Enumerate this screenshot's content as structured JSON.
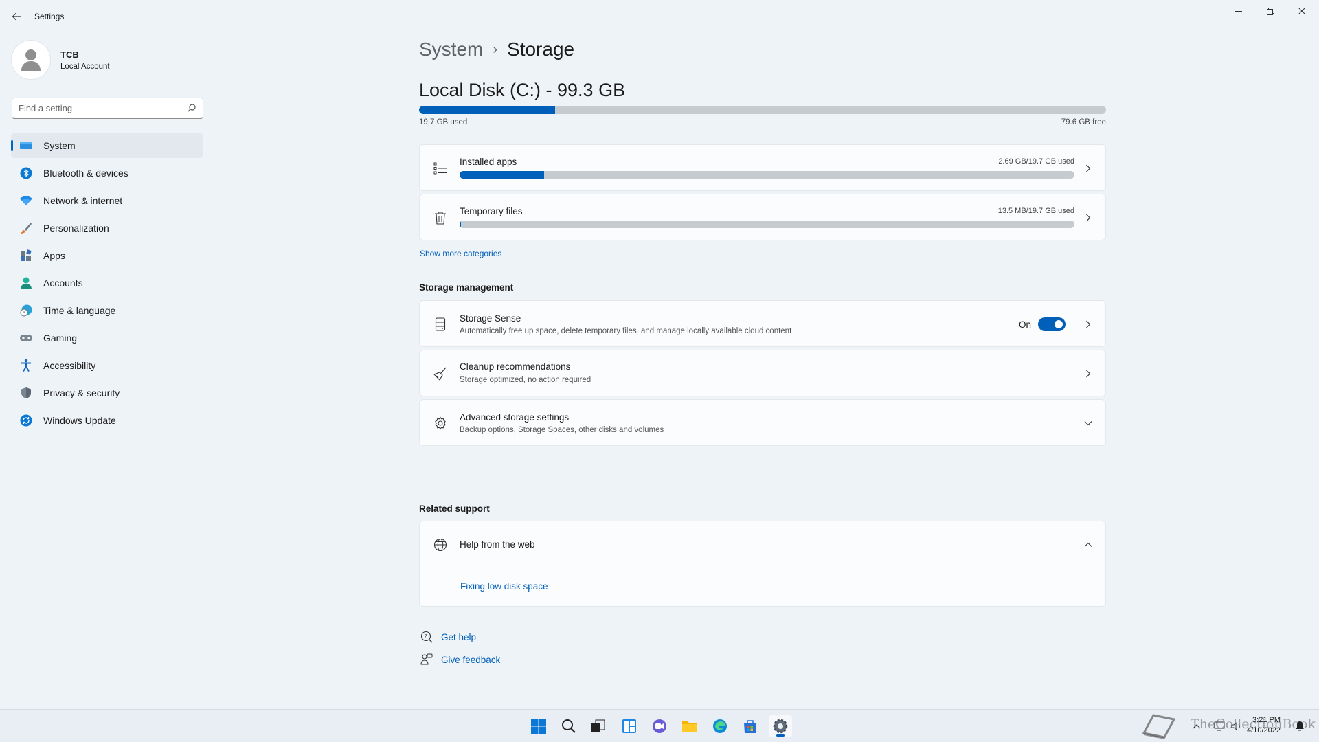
{
  "window": {
    "title": "Settings"
  },
  "profile": {
    "name": "TCB",
    "account_type": "Local Account"
  },
  "search": {
    "placeholder": "Find a setting"
  },
  "nav": [
    {
      "label": "System",
      "icon": "monitor-icon",
      "active": true
    },
    {
      "label": "Bluetooth & devices",
      "icon": "bluetooth-icon"
    },
    {
      "label": "Network & internet",
      "icon": "wifi-icon"
    },
    {
      "label": "Personalization",
      "icon": "brush-icon"
    },
    {
      "label": "Apps",
      "icon": "apps-icon"
    },
    {
      "label": "Accounts",
      "icon": "person-icon"
    },
    {
      "label": "Time & language",
      "icon": "clock-globe-icon"
    },
    {
      "label": "Gaming",
      "icon": "gamepad-icon"
    },
    {
      "label": "Accessibility",
      "icon": "accessibility-icon"
    },
    {
      "label": "Privacy & security",
      "icon": "shield-icon"
    },
    {
      "label": "Windows Update",
      "icon": "update-icon"
    }
  ],
  "breadcrumb": {
    "parent": "System",
    "separator": "›",
    "current": "Storage"
  },
  "disk": {
    "title": "Local Disk (C:) - 99.3 GB",
    "used_label": "19.7 GB used",
    "free_label": "79.6 GB free",
    "used_fraction": 0.198
  },
  "categories": [
    {
      "title": "Installed apps",
      "usage": "2.69 GB/19.7 GB used",
      "fraction": 0.137,
      "icon": "list-icon"
    },
    {
      "title": "Temporary files",
      "usage": "13.5 MB/19.7 GB used",
      "fraction": 0.002,
      "icon": "trash-icon"
    }
  ],
  "show_more": "Show more categories",
  "storage_management": {
    "heading": "Storage management",
    "storage_sense": {
      "title": "Storage Sense",
      "subtitle": "Automatically free up space, delete temporary files, and manage locally available cloud content",
      "toggle_label": "On",
      "toggle_on": true
    },
    "cleanup": {
      "title": "Cleanup recommendations",
      "subtitle": "Storage optimized, no action required"
    },
    "advanced": {
      "title": "Advanced storage settings",
      "subtitle": "Backup options, Storage Spaces, other disks and volumes"
    }
  },
  "related_support": {
    "heading": "Related support",
    "help_title": "Help from the web",
    "help_link": "Fixing low disk space"
  },
  "footer": {
    "get_help": "Get help",
    "give_feedback": "Give feedback"
  },
  "taskbar": {
    "time": "3:21 PM",
    "date": "4/10/2022",
    "watermark": "TheCollectionBook"
  },
  "colors": {
    "accent": "#005fb8",
    "background": "#eef3f8",
    "card": "#fbfcfd"
  }
}
